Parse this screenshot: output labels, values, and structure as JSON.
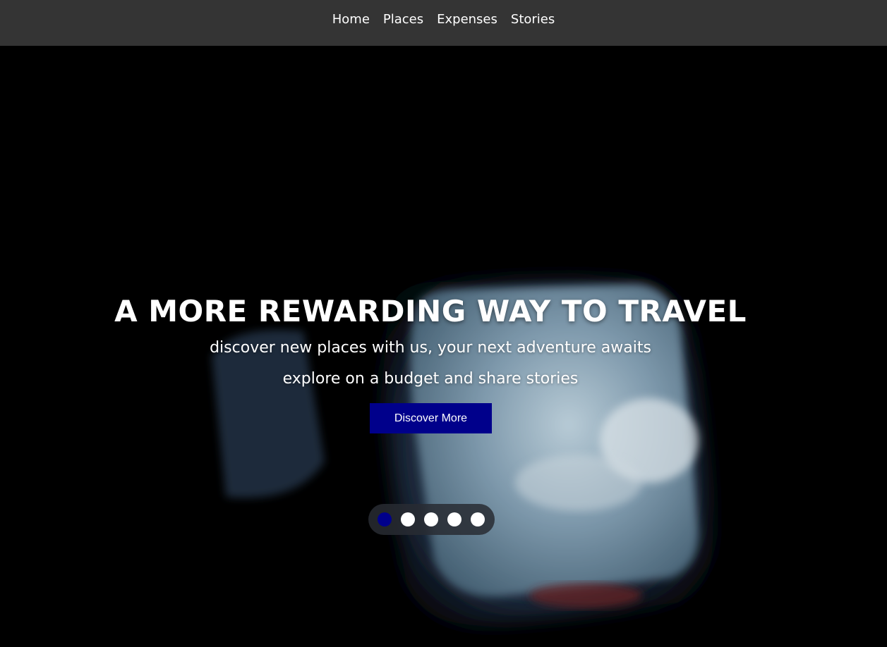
{
  "nav": {
    "links": [
      "Home",
      "Places",
      "Expenses",
      "Stories"
    ]
  },
  "hero": {
    "headline": "A MORE REWARDING WAY TO TRAVEL",
    "subline_1": "discover new places with us, your next adventure awaits",
    "subline_2": "explore on a budget and share stories",
    "cta_label": "Discover More",
    "slides": 5,
    "active_slide": 1
  },
  "colors": {
    "nav_bg": "#343434",
    "accent": "#00008b",
    "text": "#ffffff"
  }
}
